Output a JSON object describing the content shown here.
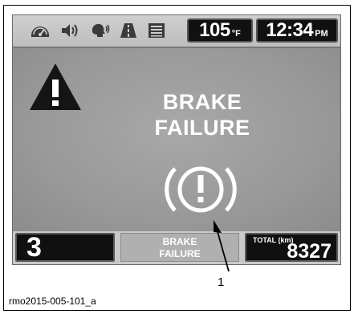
{
  "status_bar": {
    "icons": [
      "speedometer-icon",
      "speaker-icon",
      "voice-icon",
      "road-icon",
      "menu-list-icon"
    ],
    "temperature": {
      "value": "105",
      "unit": "°F"
    },
    "clock": {
      "time": "12:34",
      "period": "PM"
    }
  },
  "main": {
    "warning_icon": "warning-triangle-icon",
    "alert_title_line1": "BRAKE",
    "alert_title_line2": "FAILURE",
    "symbol_icon": "brake-warning-icon"
  },
  "bottom_bar": {
    "gear": "3",
    "message_line1": "BRAKE",
    "message_line2": "FAILURE",
    "total_label": "TOTAL (km)",
    "total_value": "8327"
  },
  "callout": {
    "number": "1"
  },
  "caption": "rmo2015-005-101_a",
  "colors": {
    "screen_bg": "#9a9a9a",
    "bar_bg": "#c9c9c9",
    "readout_bg": "#111111",
    "text_white": "#ffffff"
  }
}
